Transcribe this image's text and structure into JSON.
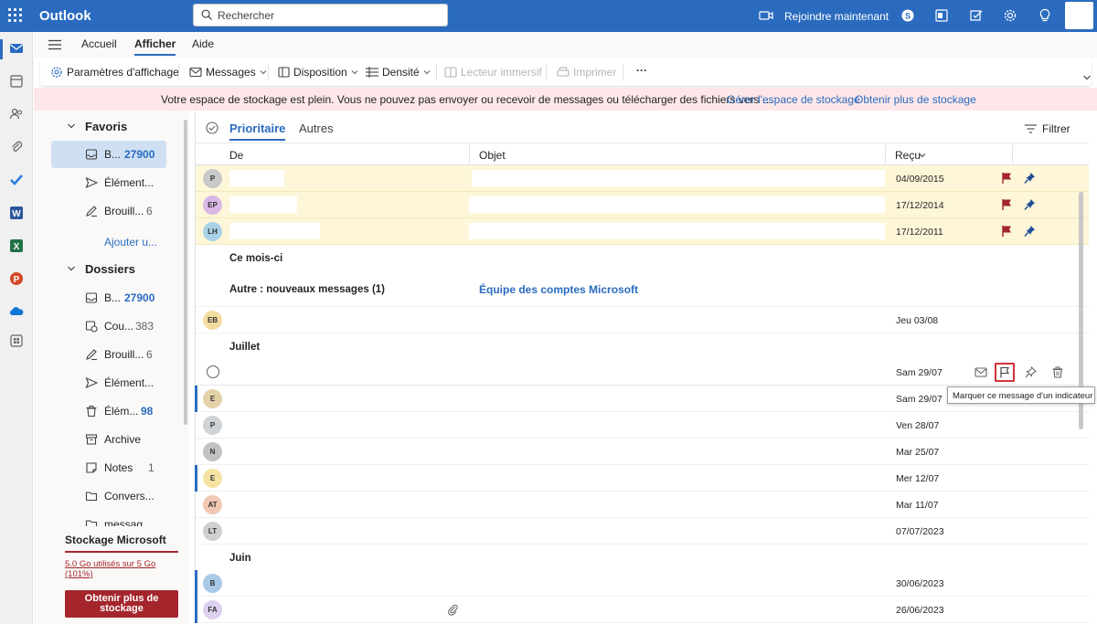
{
  "app": {
    "name": "Outlook"
  },
  "search": {
    "placeholder": "Rechercher"
  },
  "topbar": {
    "join_label": "Rejoindre maintenant"
  },
  "tabs": [
    {
      "label": "Accueil"
    },
    {
      "label": "Afficher",
      "active": true
    },
    {
      "label": "Aide"
    }
  ],
  "ribbon": {
    "view_settings": "Paramètres d'affichage",
    "messages": "Messages",
    "layout": "Disposition",
    "density": "Densité",
    "immersive_reader": "Lecteur immersif",
    "print": "Imprimer",
    "more": "···"
  },
  "banner": {
    "message": "Votre espace de stockage est plein. Vous ne pouvez pas envoyer ou recevoir de messages ou télécharger des fichiers vers …",
    "manage_link": "Gérer l'espace de stockage",
    "more_link": "Obtenir plus de stockage"
  },
  "folders": {
    "favorites_label": "Favoris",
    "folders_label": "Dossiers",
    "add_label": "Ajouter u...",
    "favorites": [
      {
        "label": "B...",
        "count": "27900",
        "icon": "inbox-icon"
      },
      {
        "label": "Élément...",
        "count": "",
        "icon": "send-icon"
      },
      {
        "label": "Brouill...",
        "count": "6",
        "icon": "draft-icon"
      }
    ],
    "items": [
      {
        "label": "B...",
        "count": "27900",
        "icon": "inbox-icon"
      },
      {
        "label": "Cou...",
        "count": "383",
        "icon": "junk-icon"
      },
      {
        "label": "Brouill...",
        "count": "6",
        "icon": "draft-icon"
      },
      {
        "label": "Élément...",
        "count": "",
        "icon": "send-icon"
      },
      {
        "label": "Élém...",
        "count": "98",
        "icon": "trash-icon"
      },
      {
        "label": "Archive",
        "count": "",
        "icon": "archive-icon"
      },
      {
        "label": "Notes",
        "count": "1",
        "icon": "notes-icon"
      },
      {
        "label": "Convers...",
        "count": "",
        "icon": "folder-icon"
      },
      {
        "label": "messag...",
        "count": "",
        "icon": "folder-icon"
      }
    ]
  },
  "storage": {
    "title": "Stockage Microsoft",
    "used": "5.0 Go utilisés sur 5 Go (101%)",
    "button": "Obtenir plus de stockage"
  },
  "list": {
    "pivot_focused": "Prioritaire",
    "pivot_other": "Autres",
    "filter": "Filtrer",
    "col_from": "De",
    "col_subject": "Objet",
    "col_received": "Reçu",
    "pinned_rows": [
      {
        "initials": "P",
        "color": "#c8c8c8",
        "date": "04/09/2015"
      },
      {
        "initials": "EP",
        "color": "#d9b8e6",
        "date": "17/12/2014"
      },
      {
        "initials": "LH",
        "color": "#a9d2e8",
        "date": "17/12/2011"
      }
    ],
    "group_this_month": "Ce mois-ci",
    "other_new": "Autre : nouveaux messages (1)",
    "other_sender": "Équipe des comptes Microsoft",
    "row_eb": {
      "initials": "EB",
      "color": "#f3dca0",
      "date": "Jeu 03/08"
    },
    "group_july": "Juillet",
    "hover_row_date": "Sam 29/07",
    "july_rows": [
      {
        "initials": "E",
        "color": "#e3d2a8",
        "date": "Sam 29/07",
        "unread": true
      },
      {
        "initials": "P",
        "color": "#cfd3d6",
        "date": "Ven 28/07",
        "unread": false
      },
      {
        "initials": "N",
        "color": "#c2c2c2",
        "date": "Mar 25/07",
        "unread": false
      },
      {
        "initials": "E",
        "color": "#f6e3a4",
        "date": "Mer 12/07",
        "unread": true
      },
      {
        "initials": "AT",
        "color": "#f1c9b3",
        "date": "Mar 11/07",
        "unread": false
      },
      {
        "initials": "LT",
        "color": "#cfcfcf",
        "date": "07/07/2023",
        "unread": false
      }
    ],
    "group_june": "Juin",
    "june_rows": [
      {
        "initials": "B",
        "color": "#a9c9e8",
        "date": "30/06/2023",
        "unread": true
      },
      {
        "initials": "FA",
        "color": "#ddd0f0",
        "date": "26/06/2023",
        "unread": true
      }
    ]
  },
  "tooltip": "Marquer ce message d'un indicateur",
  "colors": {
    "brand": "#2a6bbf",
    "flag": "#a4262c",
    "banner": "#fde7e9"
  }
}
